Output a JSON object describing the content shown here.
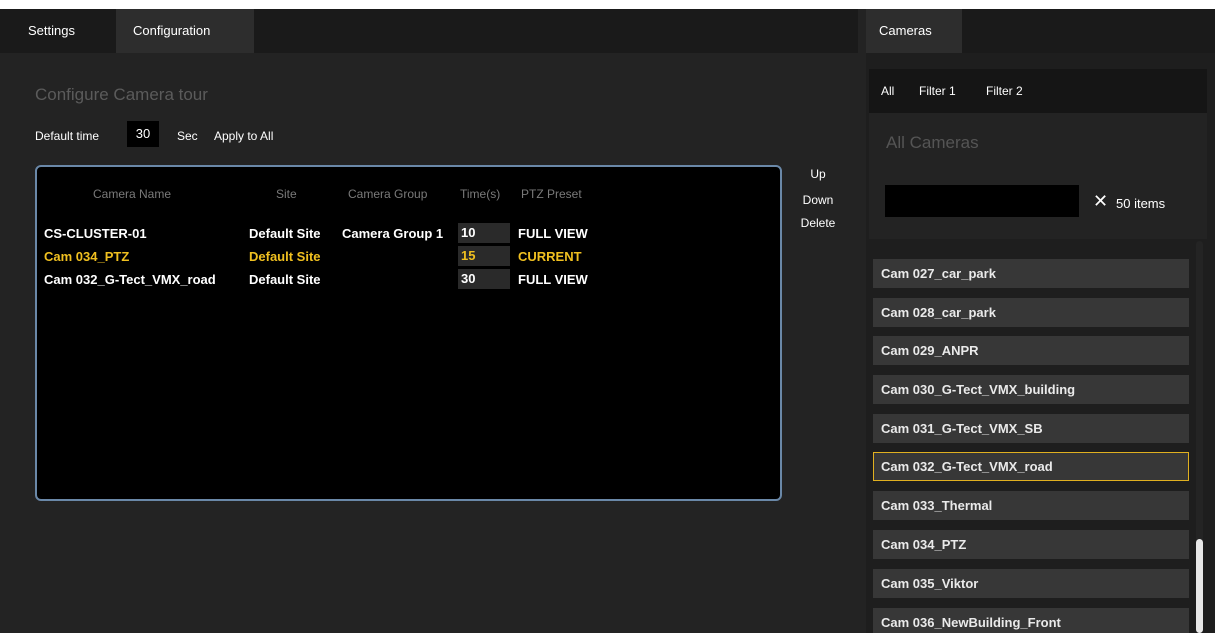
{
  "tabs": {
    "settings": "Settings",
    "configuration": "Configuration"
  },
  "config": {
    "heading": "Configure Camera tour",
    "default_time_label": "Default time",
    "default_time_value": "30",
    "sec_label": "Sec",
    "apply_label": "Apply to All"
  },
  "actions": {
    "up": "Up",
    "down": "Down",
    "delete": "Delete"
  },
  "tour": {
    "headers": {
      "camera": "Camera Name",
      "site": "Site",
      "group": "Camera Group",
      "time": "Time(s)",
      "preset": "PTZ Preset"
    },
    "rows": [
      {
        "camera": "CS-CLUSTER-01",
        "site": "Default Site",
        "group": "Camera Group 1",
        "time": "10",
        "preset": "FULL VIEW"
      },
      {
        "camera": "Cam 034_PTZ",
        "site": "Default Site",
        "group": "",
        "time": "15",
        "preset": "CURRENT"
      },
      {
        "camera": "Cam 032_G-Tect_VMX_road",
        "site": "Default Site",
        "group": "",
        "time": "30",
        "preset": "FULL VIEW"
      }
    ]
  },
  "cameras_panel": {
    "tab": "Cameras",
    "filters": [
      "All",
      "Filter 1",
      "Filter 2"
    ],
    "title": "All Cameras",
    "search_value": "",
    "clear_glyph": "✕",
    "count": "50 items",
    "list": [
      "Cam 027_car_park",
      "Cam 028_car_park",
      "Cam 029_ANPR",
      "Cam 030_G-Tect_VMX_building",
      "Cam 031_G-Tect_VMX_SB",
      "Cam 032_G-Tect_VMX_road",
      "Cam 033_Thermal",
      "Cam 034_PTZ",
      "Cam 035_Viktor",
      "Cam 036_NewBuilding_Front"
    ],
    "selected_index": 5
  },
  "colors": {
    "accent": "#f0c020",
    "border": "#6a88a8"
  }
}
